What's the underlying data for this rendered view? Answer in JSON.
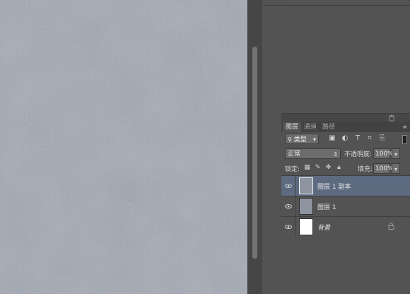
{
  "layers_panel": {
    "tabs": [
      "图层",
      "通道",
      "路径"
    ],
    "filter": {
      "kind": "类型"
    },
    "blend_mode": "正常",
    "opacity_label": "不透明度:",
    "opacity": "100%",
    "lock_label": "锁定:",
    "fill_label": "填充:",
    "fill": "100%",
    "layers": [
      {
        "name": "图层 1 副本",
        "selected": true,
        "visible": true
      },
      {
        "name": "图层 1",
        "selected": false,
        "visible": true
      },
      {
        "name": "背景",
        "selected": false,
        "visible": true,
        "locked": true
      }
    ]
  },
  "colors": {
    "canvas_texture": "#8b929d",
    "panel_bg": "#535353",
    "selected_row": "#5d6a80",
    "tab_bar": "#424242"
  },
  "icons": [
    "search-icon",
    "image-filter-icon",
    "adjust-filter-icon",
    "text-filter-icon",
    "shape-filter-icon",
    "smart-object-filter-icon",
    "trash-icon",
    "eye-icon",
    "lock-icon"
  ]
}
